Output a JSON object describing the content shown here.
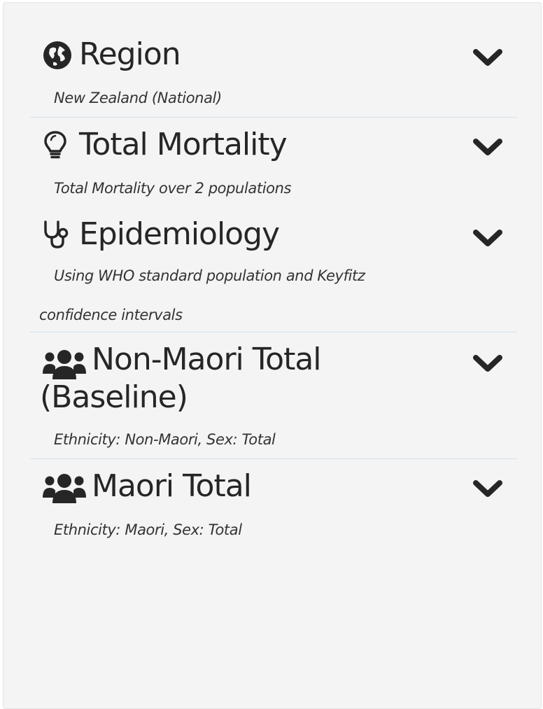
{
  "sections": [
    {
      "title": "Region",
      "icon": "globe-icon",
      "subtitle": "New Zealand (National)"
    },
    {
      "title": "Total Mortality",
      "icon": "lightbulb-icon",
      "subtitle": "Total Mortality over 2 populations"
    },
    {
      "title": "Epidemiology",
      "icon": "stethoscope-icon",
      "subtitle_line1": "Using WHO standard population and Keyfitz",
      "subtitle_line2": "confidence intervals"
    },
    {
      "title_line1": "Non-Maori Total",
      "title_line2": "(Baseline)",
      "icon": "users-icon",
      "subtitle": "Ethnicity: Non-Maori, Sex: Total"
    },
    {
      "title": "Maori Total",
      "icon": "users-icon",
      "subtitle": "Ethnicity: Maori, Sex: Total"
    }
  ],
  "colors": {
    "panel_bg": "#f4f4f4",
    "text": "#262626",
    "divider": "#d6e0ea"
  }
}
